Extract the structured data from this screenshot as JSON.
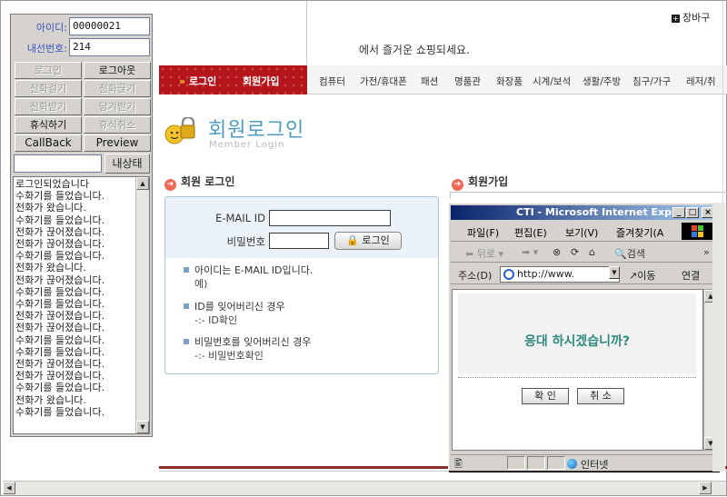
{
  "cti_panel": {
    "id_label": "아이디:",
    "id_value": "00000021",
    "ext_label": "내선번호:",
    "ext_value": "214",
    "buttons": [
      {
        "label": "로그인",
        "enabled": false
      },
      {
        "label": "로그아웃",
        "enabled": true
      },
      {
        "label": "전화걸기",
        "enabled": false
      },
      {
        "label": "전화끊기",
        "enabled": false
      },
      {
        "label": "전화받기",
        "enabled": false
      },
      {
        "label": "당겨받기",
        "enabled": false
      },
      {
        "label": "휴식하기",
        "enabled": true
      },
      {
        "label": "휴식취소",
        "enabled": false
      },
      {
        "label": "CallBack",
        "enabled": true
      },
      {
        "label": "Preview",
        "enabled": true
      }
    ],
    "status_button": "내상태",
    "log_lines": [
      "로그인되었습니다",
      "수화기를 들었습니다.",
      "전화가 왔습니다.",
      "수화기를 들었습니다.",
      "전화가 끊어졌습니다.",
      "전화가 끊어졌습니다.",
      "수화기를 들었습니다.",
      "전화가 왔습니다.",
      "전화가 끊어졌습니다.",
      "수화기를 들었습니다.",
      "수화기를 들었습니다.",
      "전화가 끊어졌습니다.",
      "전화가 끊어졌습니다.",
      "수화기를 들었습니다.",
      "수화기를 들었습니다.",
      "전화가 끊어졌습니다.",
      "전화가 끊어졌습니다.",
      "수화기를 들었습니다.",
      "전화가 왔습니다.",
      "수화기를 들었습니다."
    ]
  },
  "site": {
    "welcome_text": "에서 즐거운 쇼핑되세요.",
    "cart_link": "장바구",
    "nav_red": [
      "로그인",
      "회원가입"
    ],
    "nav_items": [
      "컴퓨터",
      "가전/휴대폰",
      "패션",
      "명품관",
      "화장품",
      "시계/보석",
      "생활/주방",
      "침구/가구",
      "레저/취"
    ],
    "page_title": "회원로그인",
    "page_subtitle": "Member Login",
    "login_section_title": "회원 로그인",
    "join_section_title": "회원가입",
    "email_label": "E-MAIL ID",
    "password_label": "비밀번호",
    "login_button": "로그인",
    "info": [
      {
        "text": "아이디는 E-MAIL ID입니다.",
        "sub": "예)"
      },
      {
        "text": "ID를 잊어버리신 경우",
        "sub": "-:- ID확인"
      },
      {
        "text": "비밀번호를 잊어버리신 경우",
        "sub": "-:- 비밀번호확인"
      }
    ]
  },
  "popup": {
    "title": "CTI - Microsoft Internet Explorer",
    "menu": [
      "파일(F)",
      "편집(E)",
      "보기(V)",
      "즐겨찾기(A"
    ],
    "toolbar": {
      "back": "뒤로",
      "search": "검색"
    },
    "address_label": "주소(D)",
    "address_value": "http://www.",
    "go_label": "이동",
    "links_label": "연결",
    "question": "응대 하시겠습니까?",
    "confirm_button": "확 인",
    "cancel_button": "취 소",
    "status_zone": "인터넷"
  },
  "colors": {
    "nav_red": "#b3151a",
    "title_blue": "#4d9cc0",
    "question_green": "#2f8a7e",
    "ie_title_start": "#0a246a",
    "panel_gray": "#d6d3ce"
  }
}
